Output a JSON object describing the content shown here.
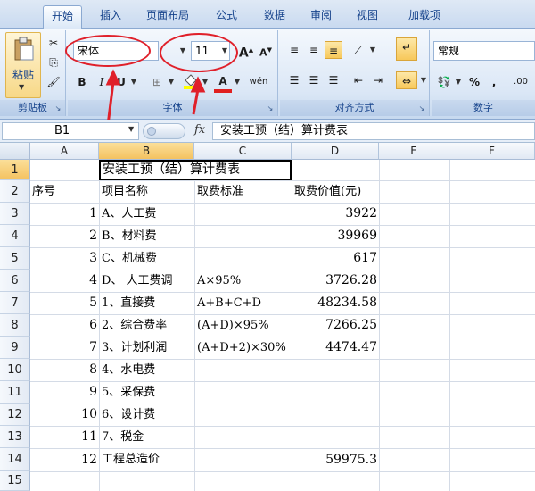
{
  "tabs": [
    "开始",
    "插入",
    "页面布局",
    "公式",
    "数据",
    "审阅",
    "视图",
    "加载项"
  ],
  "ribbon": {
    "clipboard": {
      "paste_label": "粘贴",
      "group_label": "剪贴板"
    },
    "font": {
      "font_name": "宋体",
      "font_size": "11",
      "group_label": "字体",
      "bold": "B",
      "italic": "I",
      "underline": "U",
      "grow": "A",
      "shrink": "A",
      "font_color": "A",
      "phonetic": "wén"
    },
    "alignment": {
      "group_label": "对齐方式"
    },
    "number": {
      "format": "常规",
      "percent": "%",
      "comma": ",",
      "decimal": ".00",
      "group_label": "数字"
    }
  },
  "formula_bar": {
    "name_box": "B1",
    "fx": "fx",
    "content": "安装工预（结）算计费表"
  },
  "grid": {
    "columns": [
      "A",
      "B",
      "C",
      "D",
      "E",
      "F"
    ],
    "rows": [
      "1",
      "2",
      "3",
      "4",
      "5",
      "6",
      "7",
      "8",
      "9",
      "10",
      "11",
      "12",
      "13",
      "14",
      "15"
    ],
    "cells": {
      "b1": "安装工预（结）算计费表",
      "a2": "序号",
      "b2": "项目名称",
      "c2": "取费标准",
      "d2": "取费价值(元)",
      "a3": "1",
      "b3": "A、人工费",
      "d3": "3922",
      "a4": "2",
      "b4": "B、材料费",
      "d4": "39969",
      "a5": "3",
      "b5": "C、机械费",
      "d5": "617",
      "a6": "4",
      "b6": "D、 人工费调",
      "c6": "A×95%",
      "d6": "3726.28",
      "a7": "5",
      "b7": "1、直接费",
      "c7": "A+B+C+D",
      "d7": "48234.58",
      "a8": "6",
      "b8": "2、综合费率",
      "c8": "(A+D)×95%",
      "d8": "7266.25",
      "a9": "7",
      "b9": "3、计划利润",
      "c9": "(A+D+2)×30%",
      "d9": "4474.47",
      "a10": "8",
      "b10": "4、水电费",
      "a11": "9",
      "b11": "5、采保费",
      "a12": "10",
      "b12": "6、设计费",
      "a13": "11",
      "b13": "7、税金",
      "a14": "12",
      "b14": "工程总造价",
      "d14": "59975.3"
    }
  },
  "colors": {
    "annotation": "#e0202a",
    "selection": "#f4c260",
    "ribbon_text": "#15428b"
  }
}
